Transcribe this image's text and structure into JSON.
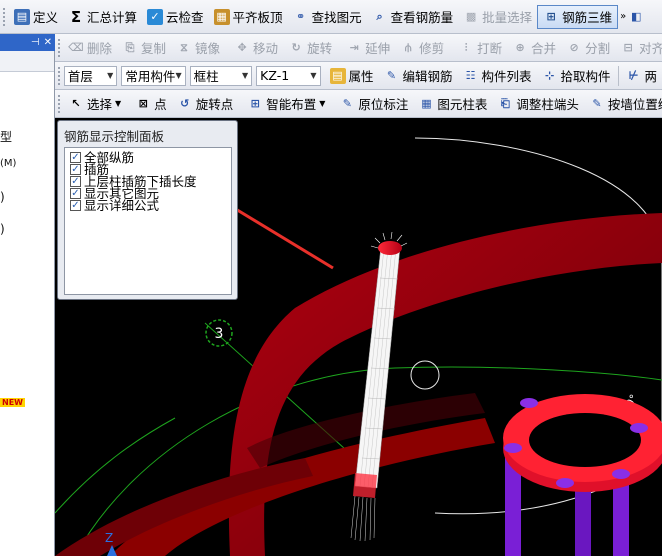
{
  "toolbar1": {
    "define": "定义",
    "summary_calc": "汇总计算",
    "cloud_check": "云检查",
    "flush_top": "平齐板顶",
    "find_element": "查找图元",
    "view_rebar_qty": "查看钢筋量",
    "batch_select": "批量选择",
    "rebar_3d": "钢筋三维"
  },
  "toolbar2": {
    "delete": "删除",
    "copy": "复制",
    "mirror": "镜像",
    "move": "移动",
    "rotate": "旋转",
    "extend": "延伸",
    "trim": "修剪",
    "break": "打断",
    "merge": "合并",
    "split": "分割",
    "align": "对齐"
  },
  "toolbar3": {
    "floor_value": "首层",
    "component_type_value": "常用构件",
    "component_value": "框柱",
    "instance_value": "KZ-1",
    "properties": "属性",
    "edit_rebar": "编辑钢筋",
    "component_list": "构件列表",
    "pick_component": "拾取构件",
    "two_points": "两"
  },
  "toolbar4": {
    "select": "选择",
    "point": "点",
    "rotate_point": "旋转点",
    "smart_layout": "智能布置",
    "original_annotation": "原位标注",
    "element_column_table": "图元柱表",
    "adjust_column_end": "调整柱端头",
    "draw_by_wall": "按墙位置绘制"
  },
  "left_pane": {
    "items": [
      "型",
      "(M)",
      ")",
      ")"
    ],
    "new_badge": "NEW"
  },
  "panel": {
    "title": "钢筋显示控制面板",
    "options": [
      {
        "label": "全部纵筋",
        "checked": true
      },
      {
        "label": "插筋",
        "checked": true
      },
      {
        "label": "上层柱插筋下插长度",
        "checked": true
      },
      {
        "label": "显示其它图元",
        "checked": true
      },
      {
        "label": "显示详细公式",
        "checked": true
      }
    ]
  },
  "viewport": {
    "axis_marker": "3",
    "axis_z": "Z",
    "degree_mark": "0°"
  },
  "colors": {
    "ring_red": "#8b0000",
    "rebar_red": "#e0102a",
    "rebar_purple": "#7a1fd6",
    "arrow_red": "#e8302a",
    "axis_green": "#1ea51e",
    "toolbar_active": "#c9dbf4"
  }
}
